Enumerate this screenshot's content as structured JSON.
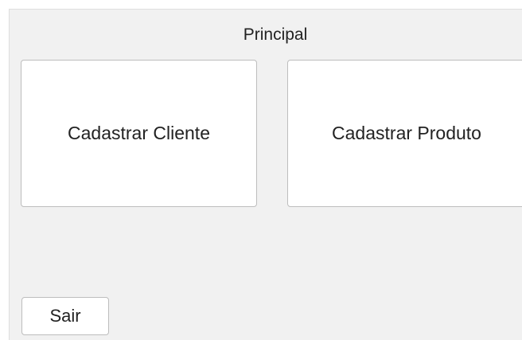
{
  "window": {
    "title": "Principal"
  },
  "buttons": {
    "cadastrar_cliente": "Cadastrar Cliente",
    "cadastrar_produto": "Cadastrar Produto",
    "sair": "Sair"
  },
  "colors": {
    "window_background": "#f1f1f1",
    "button_background": "#ffffff",
    "button_border": "#bdbdbd",
    "text": "#222222"
  }
}
